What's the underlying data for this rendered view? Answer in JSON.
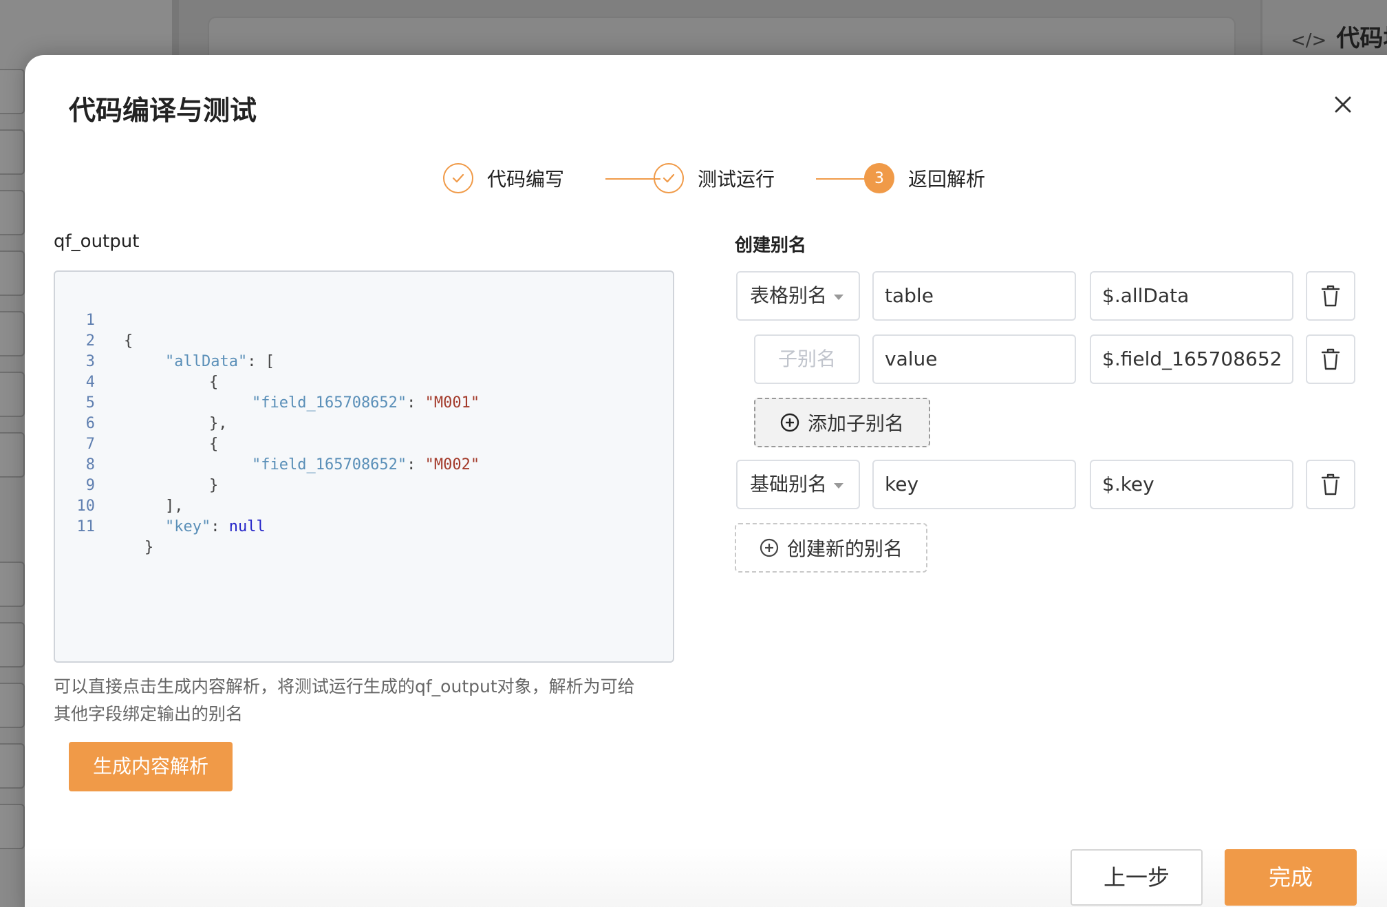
{
  "background": {
    "code_panel_title": "代码块",
    "code_panel_icon": "code-icon"
  },
  "modal": {
    "title": "代码编译与测试",
    "close_icon": "close-icon",
    "steps": [
      {
        "label": "代码编写",
        "state": "done",
        "icon": "check-icon"
      },
      {
        "label": "测试运行",
        "state": "done",
        "icon": "check-icon"
      },
      {
        "label": "返回解析",
        "state": "active",
        "number": "3"
      }
    ],
    "left": {
      "output_label": "qf_output",
      "code_lines": [
        {
          "n": "1"
        },
        {
          "n": "2"
        },
        {
          "n": "3"
        },
        {
          "n": "4"
        },
        {
          "n": "5"
        },
        {
          "n": "6"
        },
        {
          "n": "7"
        },
        {
          "n": "8"
        },
        {
          "n": "9"
        },
        {
          "n": "10"
        },
        {
          "n": "11"
        }
      ],
      "code_tokens": {
        "open_brace": "{",
        "alldata_key": "\"allData\"",
        "colon_bracket": ": [",
        "inner_open": "{",
        "field_key": "\"field_165708652\"",
        "colon": ": ",
        "m001": "\"M001\"",
        "inner_close_comma": "},",
        "inner_open2": "{",
        "field_key2": "\"field_165708652\"",
        "colon2": ": ",
        "m002": "\"M002\"",
        "inner_close": "}",
        "bracket_close": "],",
        "key_key": "\"key\"",
        "colon3": ": ",
        "null_val": "null",
        "close_brace": "}"
      },
      "hint_line1": "可以直接点击生成内容解析，将测试运行生成的qf_output对象，解析为可给",
      "hint_line2": "其他字段绑定输出的别名",
      "generate_button": "生成内容解析"
    },
    "right": {
      "title": "创建别名",
      "rows": [
        {
          "type": "表格别名",
          "name": "table",
          "path": "$.allData"
        },
        {
          "type_placeholder": "子别名",
          "name": "value",
          "path": "$.field_165708652"
        },
        {
          "type": "基础别名",
          "name": "key",
          "path": "$.key"
        }
      ],
      "add_child_button": "添加子别名",
      "create_alias_button": "创建新的别名",
      "trash_icon": "trash-icon",
      "plus_icon": "plus-circle-icon"
    },
    "footer": {
      "prev_button": "上一步",
      "finish_button": "完成"
    },
    "colors": {
      "accent": "#f09a48",
      "border": "#dcdfe4"
    }
  }
}
